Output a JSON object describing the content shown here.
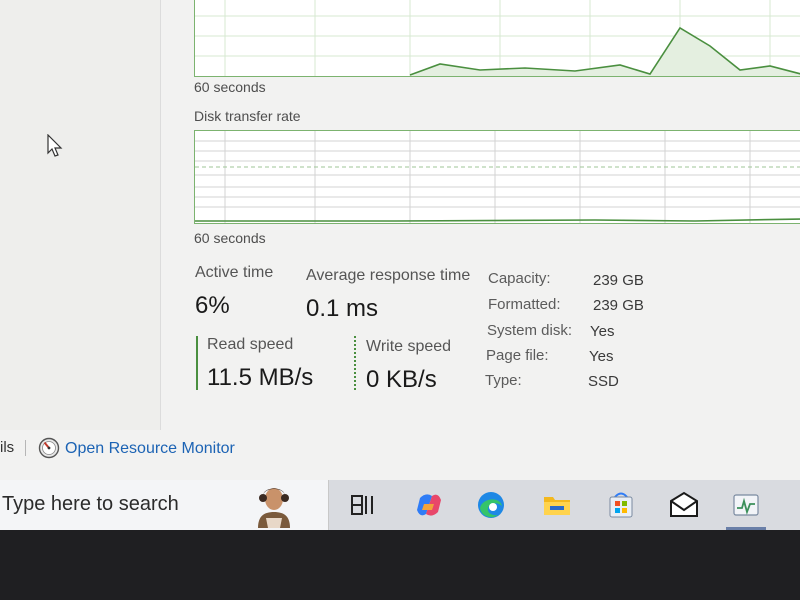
{
  "graphs": {
    "top_graph": {
      "time_label": "60 seconds"
    },
    "disk_transfer": {
      "title": "Disk transfer rate",
      "time_label": "60 seconds"
    }
  },
  "stats": {
    "active_time": {
      "label": "Active time",
      "value": "6%"
    },
    "avg_response": {
      "label": "Average response time",
      "value": "0.1 ms"
    },
    "read_speed": {
      "label": "Read speed",
      "value": "11.5 MB/s"
    },
    "write_speed": {
      "label": "Write speed",
      "value": "0 KB/s"
    }
  },
  "properties": [
    {
      "label": "Capacity:",
      "value": "239 GB"
    },
    {
      "label": "Formatted:",
      "value": "239 GB"
    },
    {
      "label": "System disk:",
      "value": "Yes"
    },
    {
      "label": "Page file:",
      "value": "Yes"
    },
    {
      "label": "Type:",
      "value": "SSD"
    }
  ],
  "footer": {
    "details_link": "ils",
    "resource_monitor_link": "Open Resource Monitor"
  },
  "taskbar": {
    "search_placeholder": "Type here to search",
    "icons": [
      "task-view-icon",
      "copilot-icon",
      "edge-icon",
      "file-explorer-icon",
      "microsoft-store-icon",
      "mail-icon",
      "task-manager-icon"
    ]
  },
  "colors": {
    "graph_line": "#4a8f3f",
    "graph_border": "#7cb36f",
    "link": "#1c63b4"
  }
}
